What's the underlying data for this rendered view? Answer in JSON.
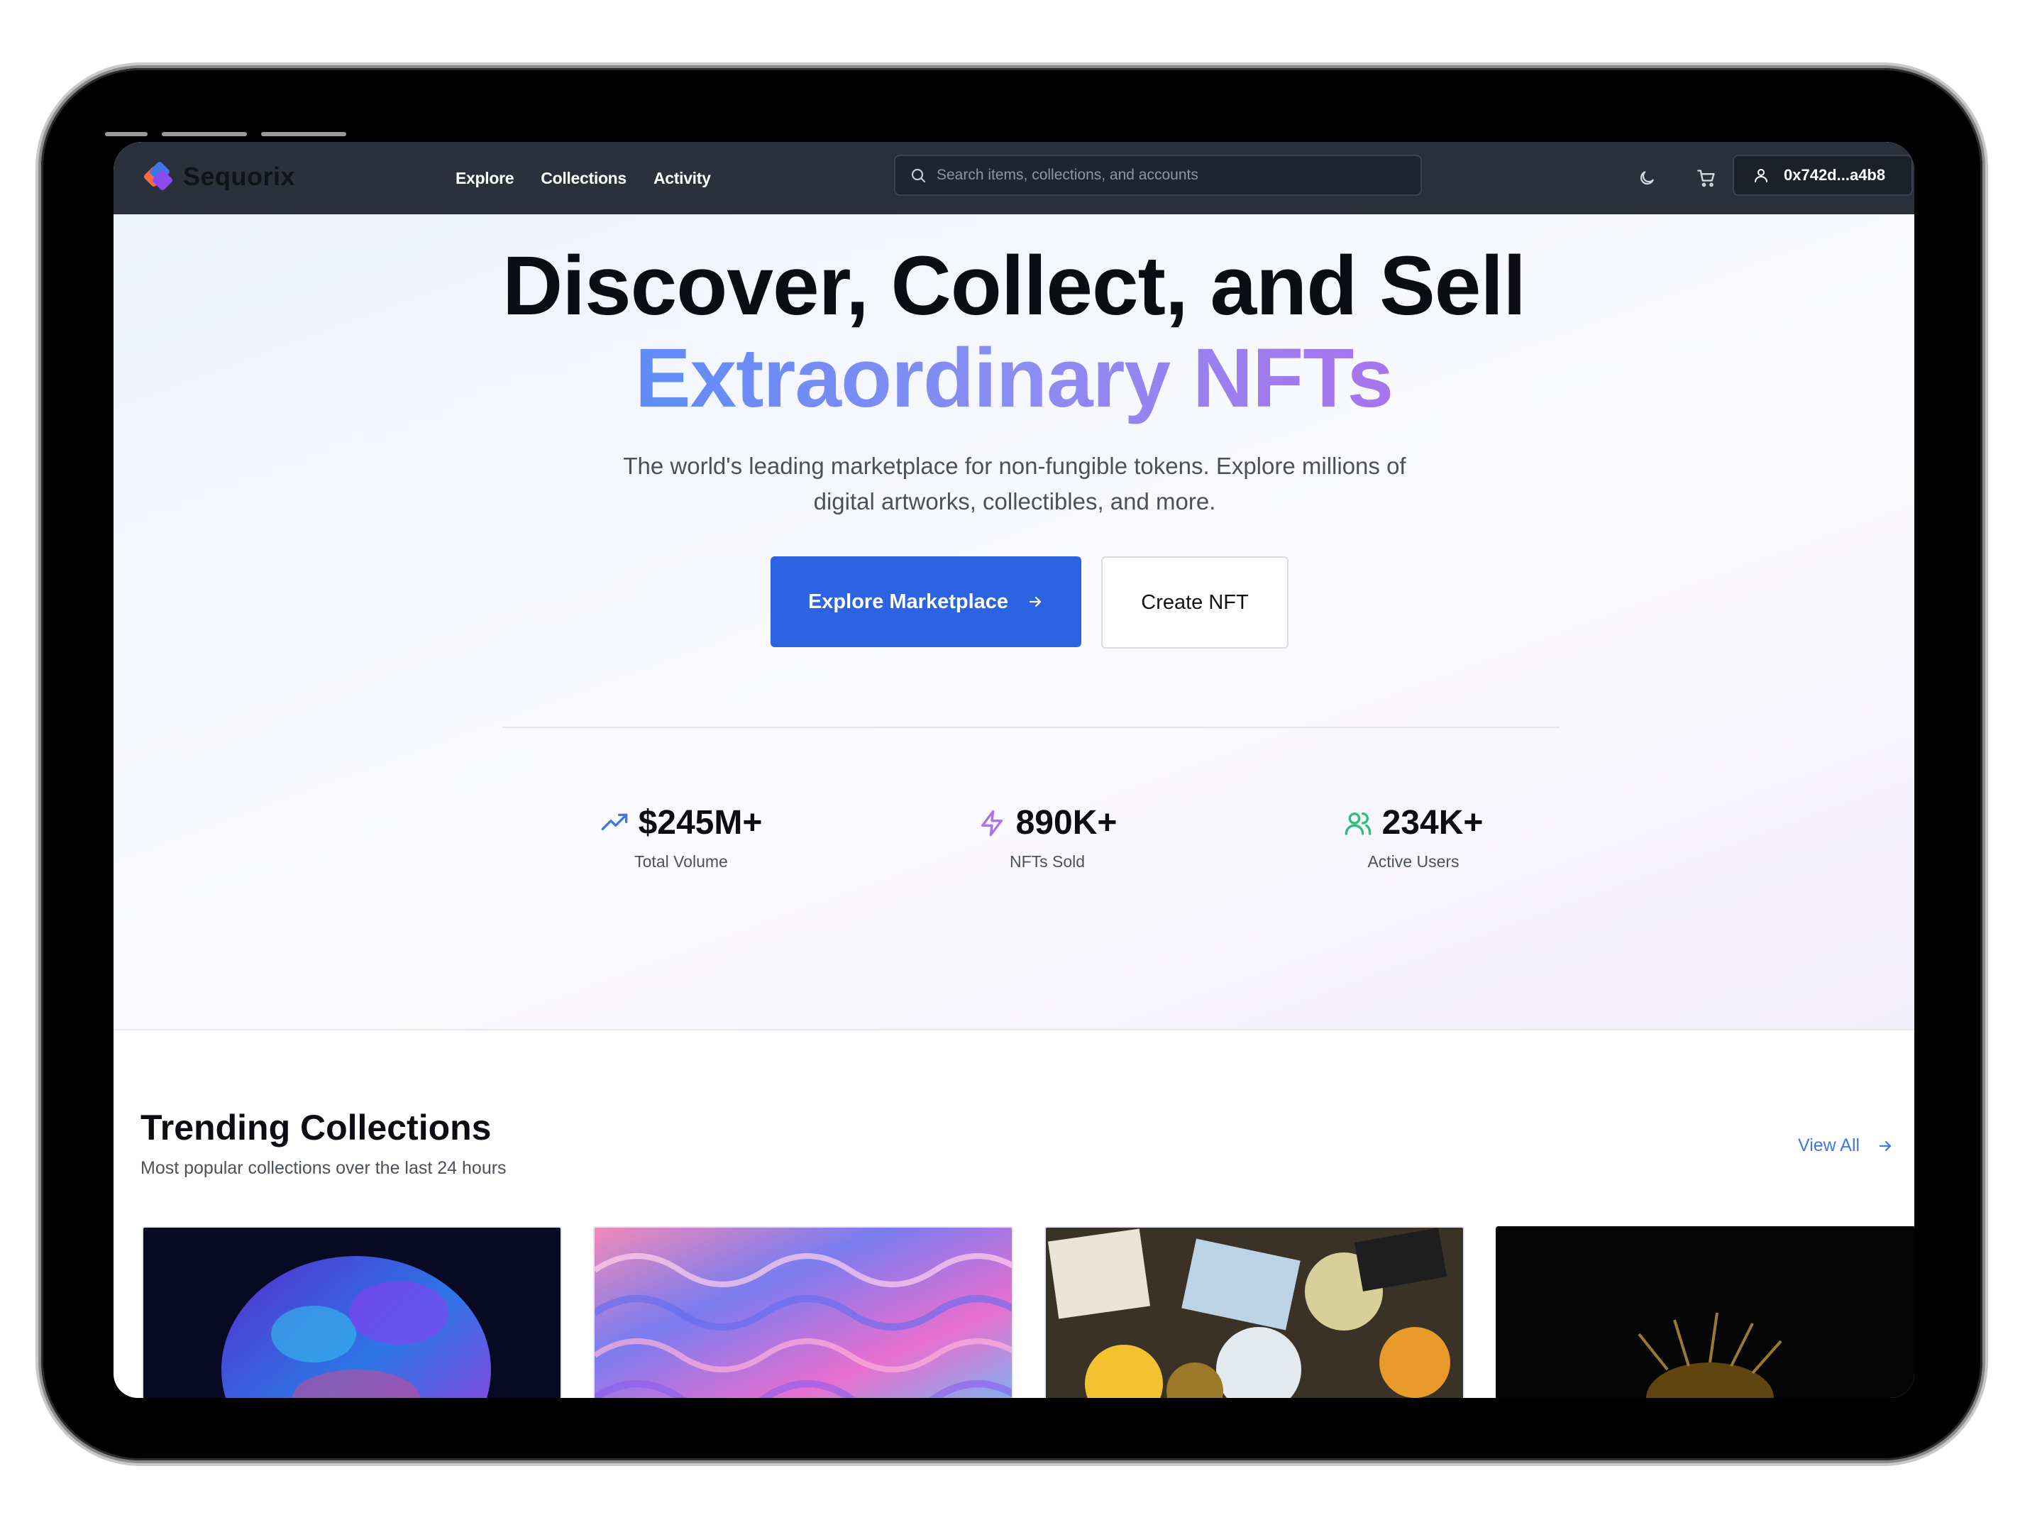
{
  "nav": {
    "brand": "Sequorix",
    "links": [
      "Explore",
      "Collections",
      "Activity"
    ],
    "search_placeholder": "Search items, collections, and accounts",
    "wallet": "0x742d...a4b8",
    "icons": [
      "moon-icon",
      "cart-icon",
      "user-icon",
      "search-icon"
    ]
  },
  "hero": {
    "title_line1": "Discover, Collect, and Sell",
    "title_line2": "Extraordinary NFTs",
    "subtitle": "The world's leading marketplace for non-fungible tokens. Explore millions of digital artworks, collectibles, and more.",
    "primary_button": "Explore Marketplace",
    "secondary_button": "Create NFT",
    "stats": [
      {
        "value": "$245M+",
        "label": "Total Volume",
        "icon": "trending-up-icon",
        "color": "#3f78e6"
      },
      {
        "value": "890K+",
        "label": "NFTs Sold",
        "icon": "zap-icon",
        "color": "#a874ee"
      },
      {
        "value": "234K+",
        "label": "Active Users",
        "icon": "users-icon",
        "color": "#2fbf74"
      }
    ]
  },
  "trending": {
    "title": "Trending Collections",
    "subtitle": "Most popular collections over the last 24 hours",
    "view_all": "View All"
  },
  "colors": {
    "accent": "#2b63e3",
    "navbar": "#2b313c",
    "gradient_start": "#5f8cf6",
    "gradient_end": "#a874ee"
  }
}
